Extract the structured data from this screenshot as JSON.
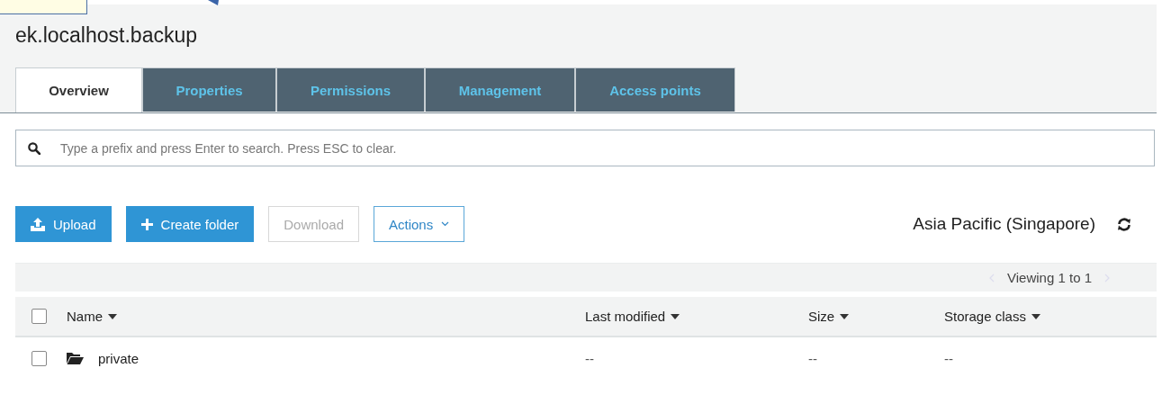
{
  "bucket": {
    "title": "ek.localhost.backup"
  },
  "tabs": [
    {
      "label": "Overview",
      "selected": true
    },
    {
      "label": "Properties",
      "selected": false
    },
    {
      "label": "Permissions",
      "selected": false
    },
    {
      "label": "Management",
      "selected": false
    },
    {
      "label": "Access points",
      "selected": false
    }
  ],
  "search": {
    "placeholder": "Type a prefix and press Enter to search. Press ESC to clear."
  },
  "toolbar": {
    "buttons": [
      {
        "kind": "upload",
        "label": "Upload",
        "disabled": false
      },
      {
        "kind": "create",
        "label": "Create folder",
        "disabled": false
      },
      {
        "kind": "plain",
        "label": "Download",
        "disabled": true
      },
      {
        "kind": "dropdown",
        "label": "Actions",
        "disabled": false
      }
    ],
    "region": "Asia Pacific (Singapore)"
  },
  "table": {
    "pager": "Viewing 1 to 1",
    "select_all": {
      "checked": false
    },
    "columns": [
      "Name",
      "Last modified",
      "Size",
      "Storage class"
    ],
    "rows": [
      {
        "kind": "folder",
        "checked": false,
        "cells": [
          "private",
          "--",
          "--",
          "--"
        ]
      }
    ]
  }
}
